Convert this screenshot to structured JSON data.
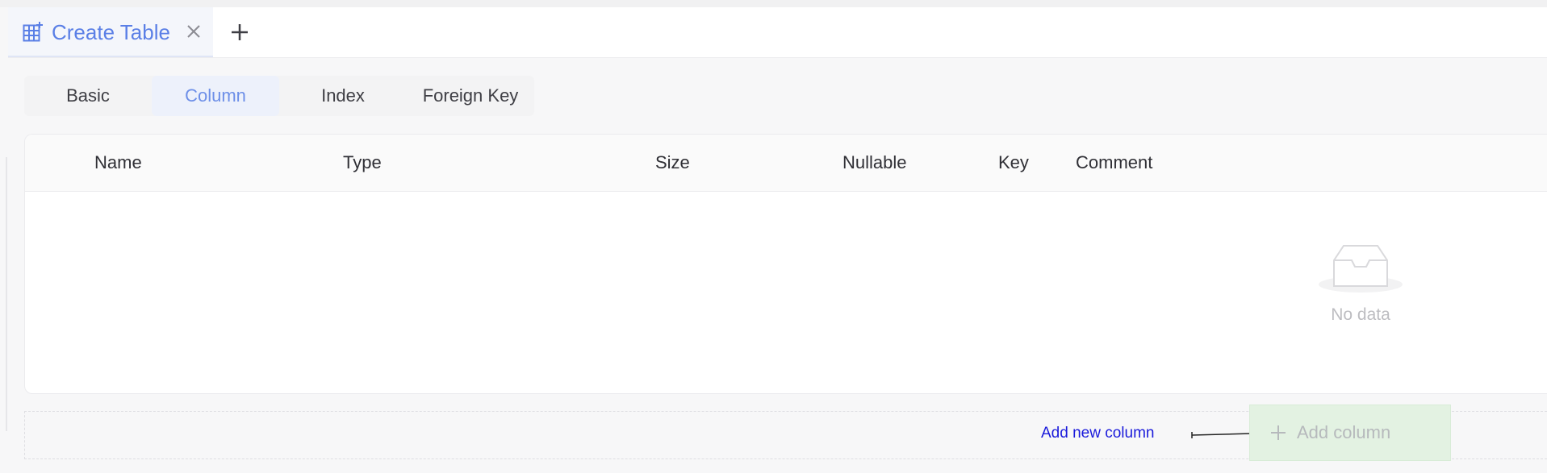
{
  "tabs": {
    "active_tab_label": "Create Table",
    "close_icon": "close-icon",
    "add_icon": "plus-icon"
  },
  "segments": {
    "items": [
      {
        "label": "Basic"
      },
      {
        "label": "Column"
      },
      {
        "label": "Index"
      },
      {
        "label": "Foreign Key"
      }
    ],
    "active": "Column"
  },
  "table": {
    "columns": [
      "Name",
      "Type",
      "Size",
      "Nullable",
      "Key",
      "Comment"
    ],
    "rows": [],
    "empty_text": "No data"
  },
  "footer": {
    "hint_text": "Add new column",
    "add_column_label": "Add column"
  },
  "colors": {
    "accent": "#5a7fe6",
    "hint": "#1a1adb",
    "add_button_bg": "#e3f2e2"
  }
}
